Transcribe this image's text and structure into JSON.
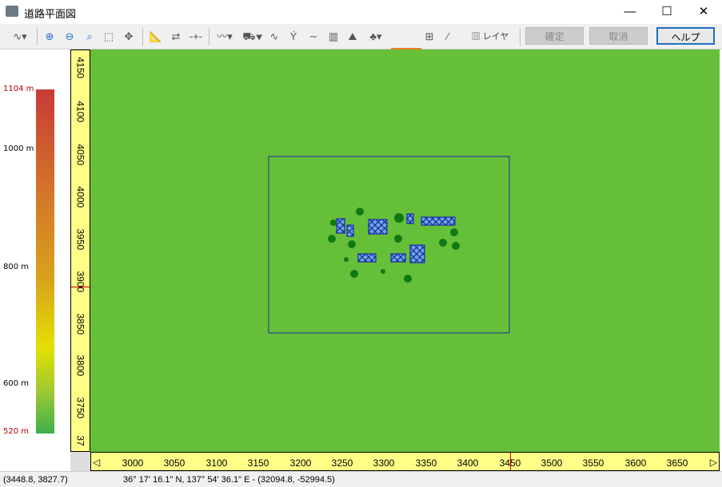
{
  "window": {
    "title": "道路平面図",
    "minimize": "—",
    "maximize": "☐",
    "close": "✕"
  },
  "toolbar": {
    "layer_label": "レイヤー",
    "confirm_label": "確定",
    "cancel_label": "取消",
    "help_label": "ヘルプ"
  },
  "legend": {
    "max": "1104 m",
    "l1000": "1000 m",
    "l800": "800 m",
    "l600": "600 m",
    "min": "520 m"
  },
  "rulers": {
    "vertical": [
      "4150",
      "4100",
      "4050",
      "4000",
      "3950",
      "3900",
      "3850",
      "3800",
      "3750",
      "37"
    ],
    "horizontal": [
      "3000",
      "3050",
      "3100",
      "3150",
      "3200",
      "3250",
      "3300",
      "3350",
      "3400",
      "3450",
      "3500",
      "3550",
      "3600",
      "3650"
    ]
  },
  "status": {
    "cursor": "(3448.8, 3827.7)",
    "geo": "36° 17' 16.1\" N, 137° 54' 36.1\" E  -  (32094.8, -52994.5)"
  },
  "colors": {
    "map": "#66bf38",
    "ruler": "#ffff88",
    "shape": "#1a2ca8",
    "tree": "#0f7a12",
    "highlight": "#f07a28"
  }
}
